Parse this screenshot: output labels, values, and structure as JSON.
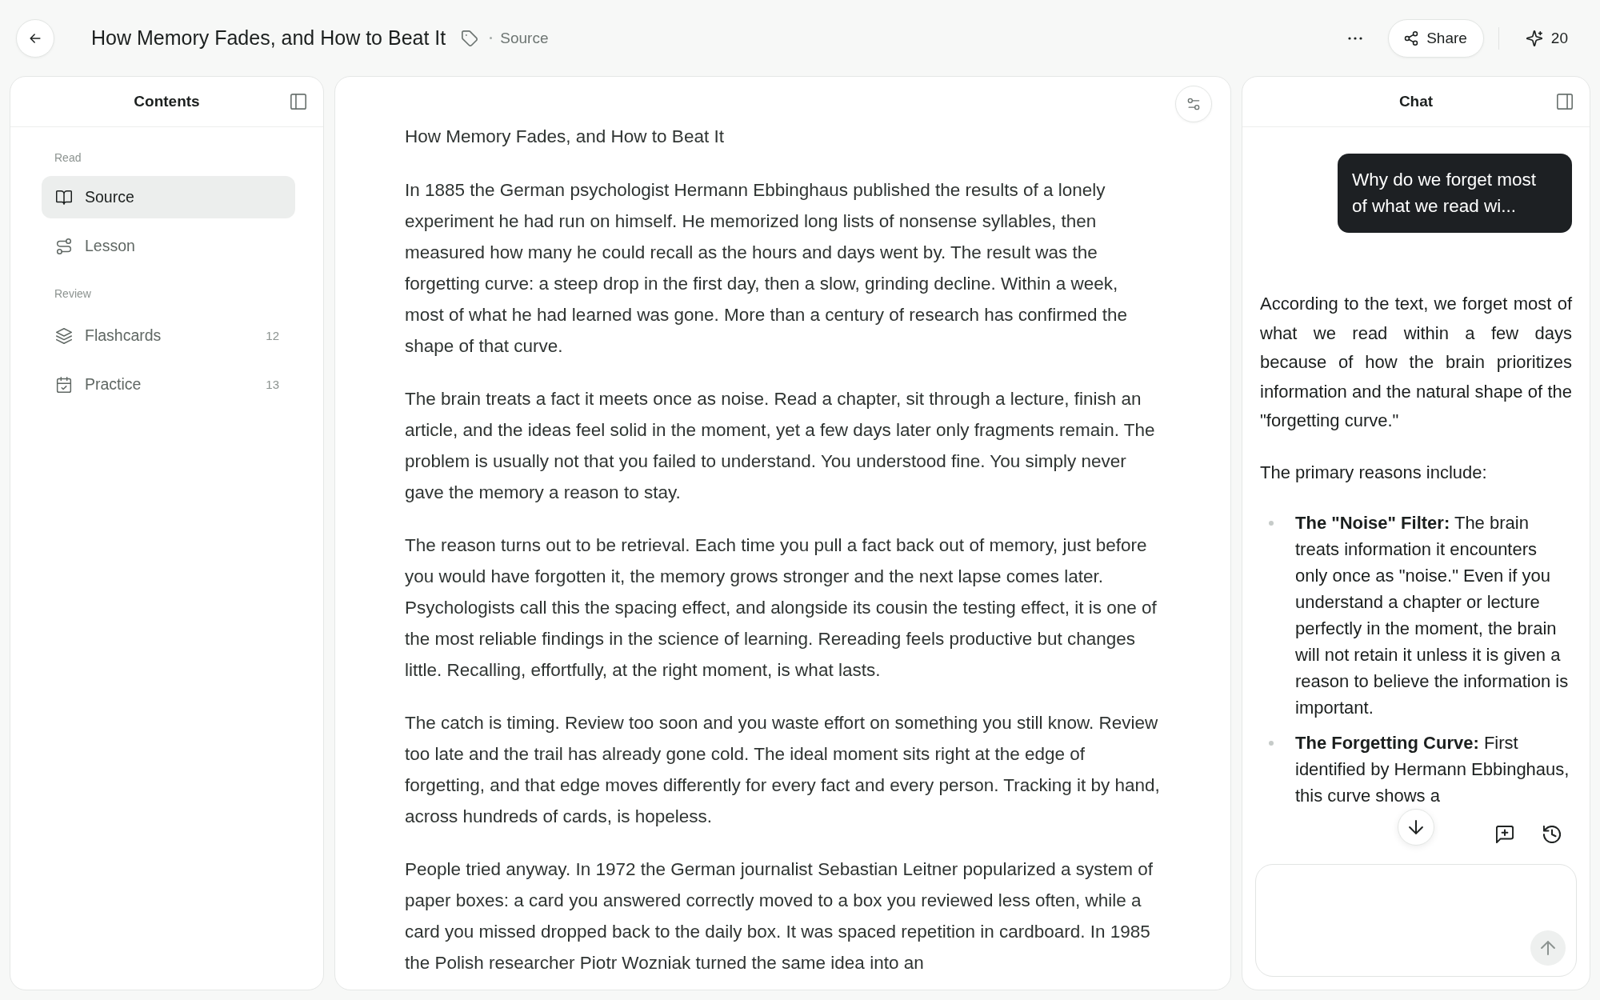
{
  "header": {
    "title": "How Memory Fades, and How to Beat It",
    "source_link": "Source",
    "share_label": "Share",
    "credits": "20"
  },
  "contents": {
    "title": "Contents",
    "sections": [
      {
        "label": "Read",
        "items": [
          {
            "label": "Source",
            "selected": true
          },
          {
            "label": "Lesson",
            "selected": false
          }
        ]
      },
      {
        "label": "Review",
        "items": [
          {
            "label": "Flashcards",
            "count": "12",
            "selected": false
          },
          {
            "label": "Practice",
            "count": "13",
            "selected": false
          }
        ]
      }
    ]
  },
  "document": {
    "title": "How Memory Fades, and How to Beat It",
    "paragraphs": [
      "In 1885 the German psychologist Hermann Ebbinghaus published the results of a lonely experiment he had run on himself. He memorized long lists of nonsense syllables, then measured how many he could recall as the hours and days went by. The result was the forgetting curve: a steep drop in the first day, then a slow, grinding decline. Within a week, most of what he had learned was gone. More than a century of research has confirmed the shape of that curve.",
      "The brain treats a fact it meets once as noise. Read a chapter, sit through a lecture, finish an article, and the ideas feel solid in the moment, yet a few days later only fragments remain. The problem is usually not that you failed to understand. You understood fine. You simply never gave the memory a reason to stay.",
      "The reason turns out to be retrieval. Each time you pull a fact back out of memory, just before you would have forgotten it, the memory grows stronger and the next lapse comes later. Psychologists call this the spacing effect, and alongside its cousin the testing effect, it is one of the most reliable findings in the science of learning. Rereading feels productive but changes little. Recalling, effortfully, at the right moment, is what lasts.",
      "The catch is timing. Review too soon and you waste effort on something you still know. Review too late and the trail has already gone cold. The ideal moment sits right at the edge of forgetting, and that edge moves differently for every fact and every person. Tracking it by hand, across hundreds of cards, is hopeless.",
      "People tried anyway. In 1972 the German journalist Sebastian Leitner popularized a system of paper boxes: a card you answered correctly moved to a box you reviewed less often, while a card you missed dropped back to the daily box. It was spaced repetition in cardboard. In 1985 the Polish researcher Piotr Wozniak turned the same idea into an"
    ]
  },
  "chat": {
    "title": "Chat",
    "messages": [
      {
        "kind": "user",
        "text": "Why do we forget most of what we read wi..."
      },
      {
        "kind": "assistant",
        "paragraphs": [
          "According to the text, we forget most of what we read within a few days because of how the brain prioritizes information and the natural shape of the \"forgetting curve.\"",
          "The primary reasons include:"
        ],
        "bullets": [
          "**The \"Noise\" Filter:** The brain treats information it encounters only once as \"noise.\" Even if you understand a chapter or lecture perfectly in the moment, the brain will not retain it unless it is given a reason to believe the information is important.",
          "**The Forgetting Curve:** First identified by Hermann Ebbinghaus, this curve shows a"
        ]
      }
    ]
  }
}
